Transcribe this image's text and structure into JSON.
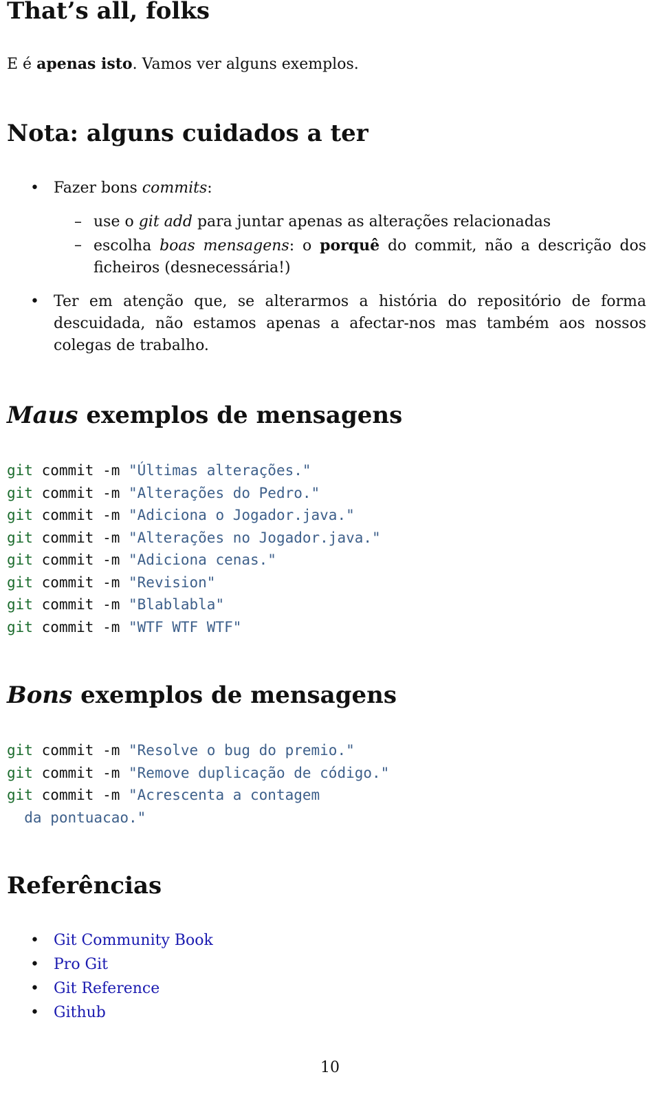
{
  "section1": {
    "title": "That’s all, folks",
    "intro_prefix": "E é ",
    "intro_bold": "apenas isto",
    "intro_suffix": ". Vamos ver alguns exemplos."
  },
  "section2": {
    "title": "Nota: alguns cuidados a ter",
    "bullet1": {
      "prefix": "Fazer bons ",
      "italic": "commits",
      "suffix": ":",
      "sub1": {
        "prefix": "use o ",
        "italic": "git add",
        "suffix": " para juntar apenas as alterações relacionadas"
      },
      "sub2": {
        "prefix": "escolha ",
        "italic": "boas mensagens",
        "mid": ": o ",
        "bold": "porquê",
        "suffix": " do commit, não a descrição dos ficheiros (desnecessária!)"
      }
    },
    "bullet2": "Ter em atenção que, se alterarmos a história do repositório de forma descuidada, não estamos apenas a afectar-nos mas também aos nossos colegas de trabalho."
  },
  "section3": {
    "title_italic": "Maus",
    "title_rest": " exemplos de mensagens",
    "keyword": "git",
    "command": " commit -m ",
    "messages": [
      "\"Últimas alterações.\"",
      "\"Alterações do Pedro.\"",
      "\"Adiciona o Jogador.java.\"",
      "\"Alterações no Jogador.java.\"",
      "\"Adiciona cenas.\"",
      "\"Revision\"",
      "\"Blablabla\"",
      "\"WTF WTF WTF\""
    ]
  },
  "section4": {
    "title_italic": "Bons",
    "title_rest": " exemplos de mensagens",
    "keyword": "git",
    "command": " commit -m ",
    "messages": [
      "\"Resolve o bug do premio.\"",
      "\"Remove duplicação de código.\"",
      "\"Acrescenta a contagem"
    ],
    "continuation": "  da pontuacao.\""
  },
  "section5": {
    "title": "Referências",
    "links": [
      "Git Community Book",
      "Pro Git",
      "Git Reference",
      "Github"
    ]
  },
  "footer": {
    "page_number": "10"
  },
  "colors": {
    "keyword": "#1a6b2c",
    "string": "#3d5f8a",
    "link": "#1a1ab0"
  }
}
